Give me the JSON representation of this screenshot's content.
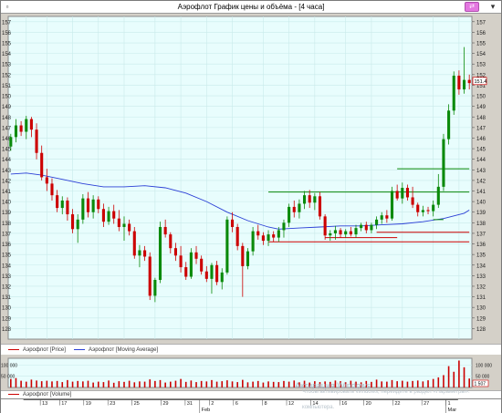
{
  "window": {
    "title": "Аэрофлот График цены и объёма - [4 часа]",
    "menu_icon": "window-menu-icon",
    "pin_icon": "pin-icon",
    "close_icon": "close-icon"
  },
  "colors": {
    "plot_bg": "#e8fdfd",
    "grid": "#c9eaea",
    "bull": "#0a8a0a",
    "bear": "#cc0000",
    "ma": "#2b3fd6",
    "support": "#cc0000",
    "resistance": "#0a8a0a",
    "volume": "#cc0000",
    "price_tag_border": "#cc0000"
  },
  "legend": {
    "price": "Аэрофлот [Price]",
    "ma": "Аэрофлот [Moving Average]",
    "volume": "Аэрофлот [Volume]"
  },
  "watermark": {
    "line1": "Активация Windows",
    "line2": "Чтобы активировать Windows, перейдите в раздел «Параметры».",
    "line3": "компьютера."
  },
  "chart_data": {
    "type": "candlestick",
    "ylim": [
      127,
      157.5
    ],
    "yticks": [
      "128",
      "129",
      "130",
      "131",
      "132",
      "133",
      "134",
      "135",
      "136",
      "137",
      "138",
      "139",
      "140",
      "141",
      "142",
      "143",
      "144",
      "145",
      "146",
      "147",
      "148",
      "149",
      "150",
      "151",
      "152",
      "153",
      "154",
      "155",
      "156",
      "157"
    ],
    "current_price": "151.4",
    "candles": [
      [
        145.2,
        146.4,
        144.8,
        146.1
      ],
      [
        146.1,
        147.8,
        145.6,
        147.2
      ],
      [
        147.2,
        147.6,
        146.2,
        146.6
      ],
      [
        146.6,
        148.1,
        145.9,
        147.8
      ],
      [
        147.8,
        148.0,
        146.1,
        146.8
      ],
      [
        146.8,
        147.4,
        144.0,
        144.6
      ],
      [
        144.6,
        145.3,
        142.0,
        142.3
      ],
      [
        142.3,
        143.1,
        141.0,
        141.7
      ],
      [
        141.7,
        142.2,
        140.1,
        140.6
      ],
      [
        140.6,
        141.1,
        139.0,
        139.4
      ],
      [
        139.4,
        140.5,
        138.8,
        140.1
      ],
      [
        140.1,
        140.4,
        138.2,
        138.8
      ],
      [
        138.8,
        139.3,
        137.0,
        137.4
      ],
      [
        137.4,
        138.8,
        136.1,
        138.3
      ],
      [
        138.3,
        140.7,
        137.9,
        140.3
      ],
      [
        140.3,
        140.9,
        138.5,
        139.0
      ],
      [
        139.0,
        140.6,
        138.4,
        140.2
      ],
      [
        140.2,
        140.5,
        138.9,
        139.3
      ],
      [
        139.3,
        139.8,
        137.6,
        138.1
      ],
      [
        138.1,
        139.5,
        137.8,
        139.1
      ],
      [
        139.1,
        139.7,
        137.9,
        138.4
      ],
      [
        138.4,
        139.2,
        137.2,
        137.6
      ],
      [
        137.6,
        138.6,
        136.3,
        137.9
      ],
      [
        137.9,
        138.3,
        136.8,
        137.2
      ],
      [
        137.2,
        137.6,
        134.6,
        134.9
      ],
      [
        134.9,
        135.9,
        133.8,
        135.4
      ],
      [
        135.4,
        135.8,
        134.4,
        134.8
      ],
      [
        134.8,
        135.2,
        130.7,
        131.1
      ],
      [
        131.1,
        132.8,
        130.5,
        132.6
      ],
      [
        132.6,
        138.1,
        132.3,
        137.6
      ],
      [
        137.6,
        138.3,
        136.6,
        136.9
      ],
      [
        136.9,
        137.1,
        135.1,
        135.6
      ],
      [
        135.6,
        136.1,
        134.4,
        134.9
      ],
      [
        134.9,
        135.8,
        133.3,
        133.8
      ],
      [
        133.8,
        134.3,
        132.6,
        132.9
      ],
      [
        132.9,
        135.6,
        132.7,
        135.2
      ],
      [
        135.2,
        135.8,
        134.1,
        134.6
      ],
      [
        134.6,
        134.9,
        133.1,
        133.4
      ],
      [
        133.4,
        133.9,
        132.4,
        132.7
      ],
      [
        132.7,
        134.2,
        131.3,
        134.0
      ],
      [
        134.0,
        134.4,
        132.1,
        132.4
      ],
      [
        132.4,
        133.7,
        131.7,
        133.3
      ],
      [
        133.3,
        138.6,
        133.1,
        138.3
      ],
      [
        138.3,
        139.0,
        137.1,
        137.6
      ],
      [
        137.6,
        137.9,
        135.4,
        135.8
      ],
      [
        135.8,
        136.1,
        131.0,
        133.9
      ],
      [
        133.9,
        135.6,
        133.6,
        135.3
      ],
      [
        135.3,
        137.6,
        134.9,
        137.2
      ],
      [
        137.2,
        137.8,
        136.4,
        136.8
      ],
      [
        136.8,
        137.1,
        135.9,
        136.3
      ],
      [
        136.3,
        137.3,
        135.8,
        136.9
      ],
      [
        136.9,
        137.2,
        136.2,
        136.6
      ],
      [
        136.6,
        137.6,
        136.2,
        137.3
      ],
      [
        137.3,
        138.3,
        136.6,
        138.0
      ],
      [
        138.0,
        139.8,
        137.6,
        139.5
      ],
      [
        139.5,
        140.1,
        138.5,
        139.0
      ],
      [
        139.0,
        140.2,
        138.4,
        139.8
      ],
      [
        139.8,
        141.0,
        139.3,
        140.6
      ],
      [
        140.6,
        141.1,
        139.4,
        139.9
      ],
      [
        139.9,
        140.8,
        139.2,
        140.5
      ],
      [
        140.5,
        140.9,
        138.3,
        138.6
      ],
      [
        138.6,
        138.8,
        136.4,
        136.8
      ],
      [
        136.8,
        137.3,
        136.3,
        137.0
      ],
      [
        137.0,
        137.7,
        136.4,
        137.3
      ],
      [
        137.3,
        137.5,
        136.6,
        136.9
      ],
      [
        136.9,
        137.4,
        136.6,
        137.2
      ],
      [
        137.2,
        137.6,
        136.7,
        136.9
      ],
      [
        136.9,
        137.8,
        136.6,
        137.5
      ],
      [
        137.5,
        138.0,
        137.2,
        137.8
      ],
      [
        137.8,
        138.1,
        137.0,
        137.3
      ],
      [
        137.3,
        138.0,
        137.0,
        137.8
      ],
      [
        137.8,
        138.6,
        137.4,
        138.3
      ],
      [
        138.3,
        139.0,
        137.9,
        138.7
      ],
      [
        138.7,
        139.2,
        138.0,
        138.4
      ],
      [
        138.4,
        141.4,
        138.2,
        141.0
      ],
      [
        141.0,
        141.6,
        140.1,
        140.3
      ],
      [
        140.3,
        141.8,
        139.8,
        141.3
      ],
      [
        141.3,
        141.6,
        140.1,
        140.4
      ],
      [
        140.4,
        141.4,
        139.4,
        139.7
      ],
      [
        139.7,
        139.9,
        138.6,
        139.0
      ],
      [
        139.0,
        139.6,
        138.6,
        139.2
      ],
      [
        139.2,
        139.5,
        138.8,
        139.1
      ],
      [
        139.1,
        140.1,
        138.6,
        139.7
      ],
      [
        139.7,
        142.6,
        139.4,
        141.4
      ],
      [
        141.4,
        146.4,
        141.0,
        145.9
      ],
      [
        145.9,
        149.2,
        145.4,
        148.6
      ],
      [
        148.6,
        152.3,
        148.2,
        151.9
      ],
      [
        151.9,
        152.4,
        150.1,
        150.6
      ],
      [
        150.6,
        154.6,
        150.2,
        151.5
      ],
      [
        151.5,
        152.0,
        150.6,
        151.2
      ]
    ],
    "moving_average": [
      [
        0,
        142.6
      ],
      [
        3,
        142.7
      ],
      [
        6,
        142.5
      ],
      [
        10,
        142.1
      ],
      [
        14,
        141.7
      ],
      [
        18,
        141.4
      ],
      [
        22,
        141.4
      ],
      [
        26,
        141.5
      ],
      [
        30,
        141.3
      ],
      [
        34,
        140.8
      ],
      [
        38,
        140.0
      ],
      [
        42,
        139.0
      ],
      [
        46,
        138.2
      ],
      [
        50,
        137.6
      ],
      [
        52,
        137.4
      ],
      [
        56,
        137.5
      ],
      [
        60,
        137.6
      ],
      [
        64,
        137.7
      ],
      [
        68,
        137.7
      ],
      [
        72,
        137.8
      ],
      [
        76,
        137.9
      ],
      [
        80,
        138.1
      ],
      [
        84,
        138.4
      ],
      [
        88,
        138.9
      ],
      [
        89,
        139.2
      ]
    ],
    "levels": [
      {
        "kind": "support",
        "value": 136.2,
        "from": 50,
        "to": 89
      },
      {
        "kind": "support",
        "value": 136.6,
        "from": 61,
        "to": 75
      },
      {
        "kind": "support",
        "value": 137.1,
        "from": 71,
        "to": 89
      },
      {
        "kind": "resistance",
        "value": 140.9,
        "from": 50,
        "to": 89
      },
      {
        "kind": "resistance",
        "value": 143.1,
        "from": 75,
        "to": 89
      },
      {
        "kind": "resistance",
        "value": 138.3,
        "from": 82,
        "to": 84
      }
    ],
    "volume": {
      "yticks": [
        "100 000",
        "50 000"
      ],
      "label_right": [
        "100 000",
        "50 000"
      ],
      "current": "1 507",
      "max": 130000,
      "values": [
        38000,
        42000,
        30000,
        26000,
        35000,
        31000,
        28000,
        30000,
        27000,
        29000,
        24000,
        33000,
        26000,
        29000,
        27000,
        30000,
        22000,
        26000,
        24000,
        31000,
        21000,
        28000,
        25000,
        30000,
        23000,
        27000,
        26000,
        36000,
        29000,
        33000,
        22000,
        26000,
        30000,
        38000,
        25000,
        31000,
        24000,
        29000,
        27000,
        33000,
        26000,
        28000,
        32000,
        27000,
        24000,
        34000,
        23000,
        26000,
        29000,
        22000,
        27000,
        25000,
        24000,
        29000,
        26000,
        31000,
        23000,
        30000,
        22000,
        28000,
        24000,
        27000,
        25000,
        31000,
        28000,
        24000,
        30000,
        26000,
        23000,
        29000,
        25000,
        35000,
        27000,
        26000,
        33000,
        28000,
        30000,
        26000,
        29000,
        31000,
        27000,
        32000,
        38000,
        45000,
        55000,
        95000,
        70000,
        120000,
        90000,
        40000
      ]
    },
    "x_ticks": [
      {
        "i": 3,
        "label": "13"
      },
      {
        "i": 7,
        "label": "17"
      },
      {
        "i": 12,
        "label": "19"
      },
      {
        "i": 17,
        "label": "23"
      },
      {
        "i": 22,
        "label": "25"
      },
      {
        "i": 28,
        "label": "29"
      },
      {
        "i": 33,
        "label": "31"
      },
      {
        "i": 38,
        "label": "2"
      },
      {
        "i": 43,
        "label": "6"
      },
      {
        "i": 49,
        "label": "8"
      },
      {
        "i": 54,
        "label": "12"
      },
      {
        "i": 59,
        "label": "14"
      },
      {
        "i": 65,
        "label": "16"
      },
      {
        "i": 70,
        "label": "20"
      },
      {
        "i": 76,
        "label": "22"
      },
      {
        "i": 82,
        "label": "27"
      },
      {
        "i": 87,
        "label": "1"
      }
    ],
    "x_months": [
      {
        "i": 36,
        "label": "Feb"
      },
      {
        "i": 87,
        "label": "Mar"
      }
    ]
  }
}
